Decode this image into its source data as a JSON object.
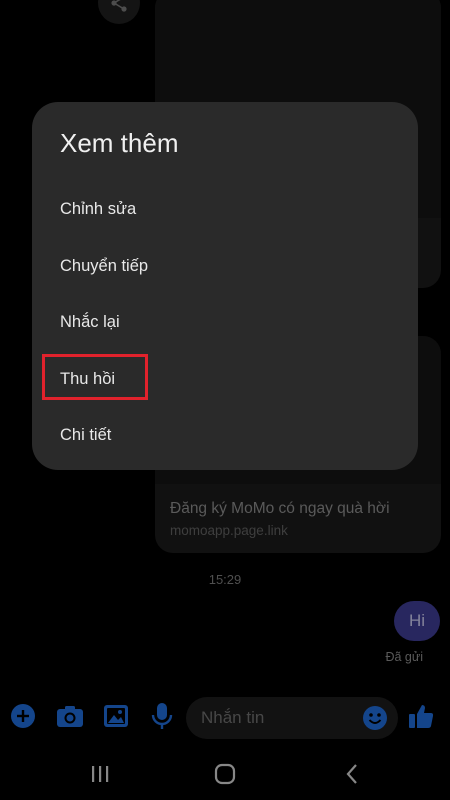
{
  "conversation": {
    "link_preview": {
      "title": "Đăng ký MoMo có ngay quà hời",
      "url": "momoapp.page.link"
    },
    "timestamp": "15:29",
    "sent_message": "Hi",
    "sent_status": "Đã gửi"
  },
  "composer": {
    "placeholder": "Nhắn tin",
    "icons": [
      "plus-icon",
      "camera-icon",
      "gallery-icon",
      "microphone-icon",
      "emoji-icon",
      "thumbs-up-icon"
    ],
    "accent_color": "#1f6ad6"
  },
  "dialog": {
    "title": "Xem thêm",
    "items": [
      {
        "label": "Chỉnh sửa"
      },
      {
        "label": "Chuyển tiếp"
      },
      {
        "label": "Nhắc lại"
      },
      {
        "label": "Thu hồi",
        "highlighted": true
      },
      {
        "label": "Chi tiết"
      }
    ],
    "highlight_color": "#e1222c"
  },
  "navigation": {
    "icons": [
      "recent-apps-icon",
      "home-icon",
      "back-icon"
    ]
  }
}
